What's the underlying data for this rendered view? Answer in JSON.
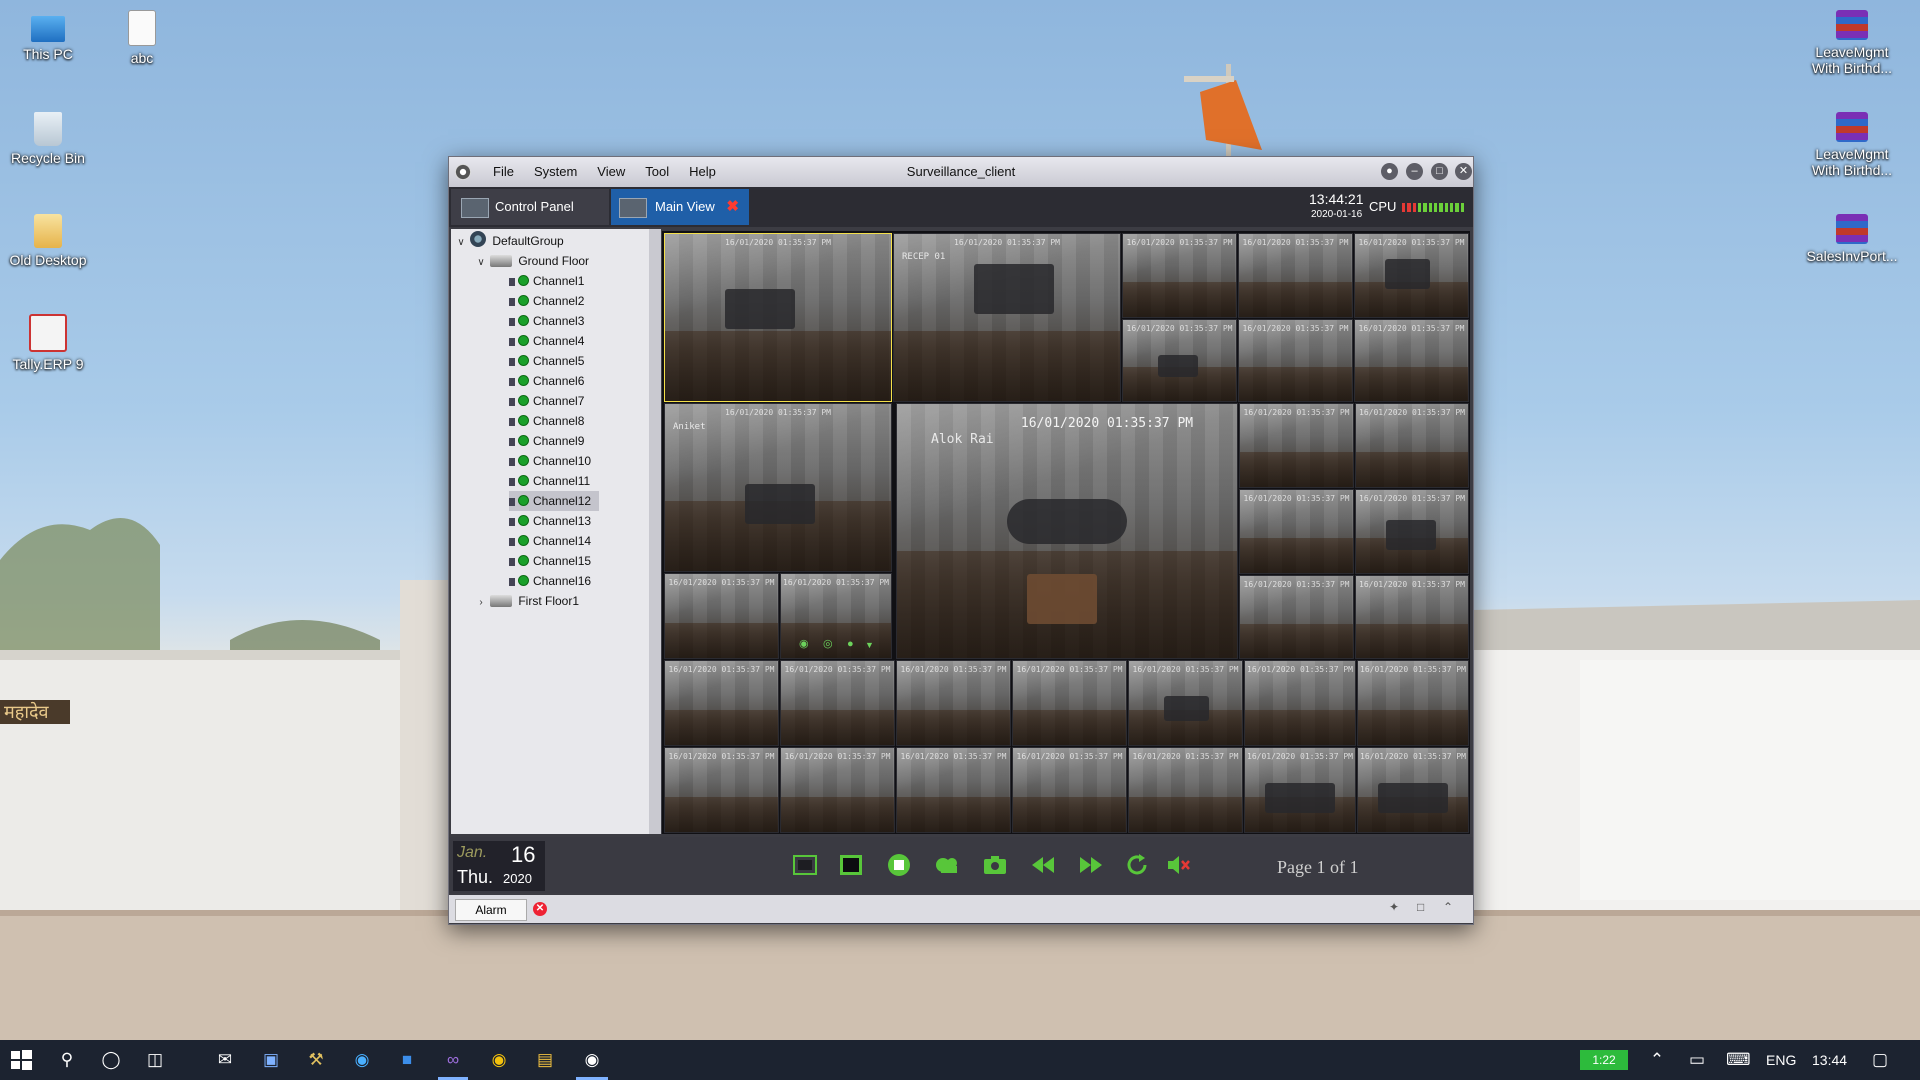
{
  "desktop": {
    "left_icons": [
      {
        "label": "This PC",
        "icon": "this-pc-icon"
      },
      {
        "label": "abc",
        "icon": "text-file-icon"
      },
      {
        "label": "Recycle Bin",
        "icon": "recycle-bin-icon"
      },
      {
        "label": "Old Desktop",
        "icon": "folder-icon"
      },
      {
        "label": "Tally.ERP 9",
        "icon": "tally-icon"
      }
    ],
    "right_icons": [
      {
        "label": "LeaveMgmt With Birthd...",
        "icon": "winrar-archive-icon"
      },
      {
        "label": "LeaveMgmt With Birthd...",
        "icon": "winrar-archive-icon"
      },
      {
        "label": "SalesInvPort...",
        "icon": "winrar-archive-icon"
      }
    ],
    "wall_sign": "महादेव"
  },
  "window": {
    "title": "Surveillance_client",
    "menu": [
      "File",
      "System",
      "View",
      "Tool",
      "Help"
    ],
    "tabs": [
      {
        "label": "Control Panel",
        "active": false
      },
      {
        "label": "Main View",
        "active": true
      }
    ],
    "clock_time": "13:44:21",
    "clock_date": "2020-01-16",
    "cpu_label": "CPU"
  },
  "tree": {
    "root": "DefaultGroup",
    "group": "Ground Floor",
    "channels": [
      "Channel1",
      "Channel2",
      "Channel3",
      "Channel4",
      "Channel5",
      "Channel6",
      "Channel7",
      "Channel8",
      "Channel9",
      "Channel10",
      "Channel11",
      "Channel12",
      "Channel13",
      "Channel14",
      "Channel15",
      "Channel16"
    ],
    "selected_channel": "Channel12",
    "group2": "First Floor1"
  },
  "video": {
    "big_timestamp": "16/01/2020 01:35:37 PM",
    "big_name": "Alok Rai",
    "tile_names": {
      "t1": "",
      "t2": "RECEP 01",
      "t7": "Aniket"
    },
    "small_timestamp": "16/01/2020 01:35:37 PM"
  },
  "bottom": {
    "month": "Jan.",
    "day": "16",
    "weekday": "Thu.",
    "year": "2020",
    "page_info": "Page 1 of 1",
    "alarm_label": "Alarm"
  },
  "taskbar": {
    "battery": "1:22",
    "lang": "ENG",
    "time": "13:44"
  }
}
